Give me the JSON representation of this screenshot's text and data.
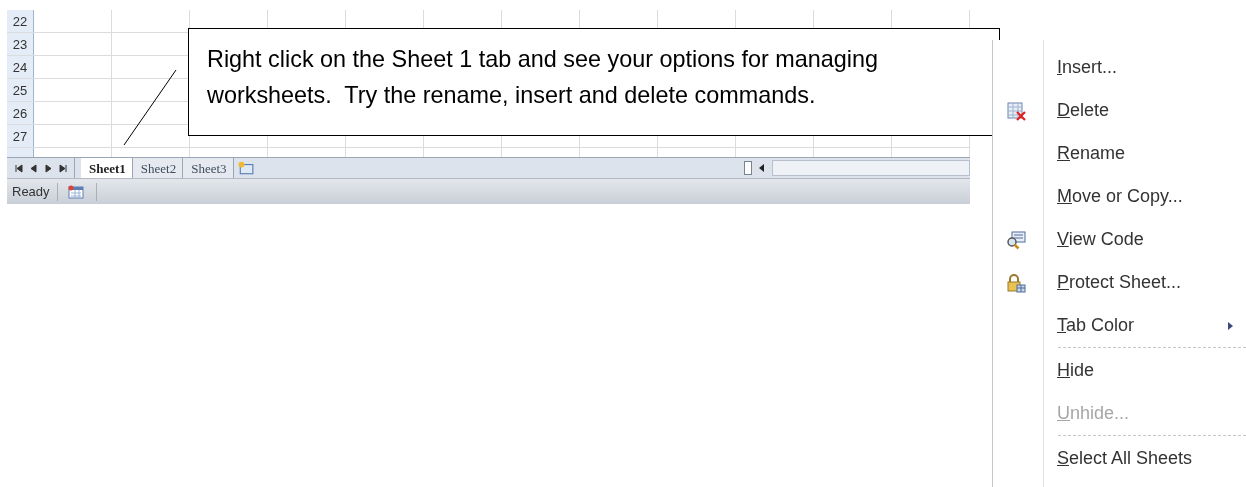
{
  "grid": {
    "row_labels": [
      "22",
      "23",
      "24",
      "25",
      "26",
      "27"
    ]
  },
  "sheet_tabs": [
    {
      "label": "Sheet1",
      "selected": true
    },
    {
      "label": "Sheet2",
      "selected": false
    },
    {
      "label": "Sheet3",
      "selected": false
    }
  ],
  "status_bar": {
    "text": "Ready"
  },
  "callout": {
    "text": "Right click on the Sheet 1 tab and see your options for managing worksheets.  Try the rename, insert and delete commands."
  },
  "context_menu": {
    "items": [
      {
        "kind": "item",
        "label": "Insert...",
        "disabled": false,
        "submenu": false
      },
      {
        "kind": "delete",
        "label": "Delete",
        "disabled": false,
        "submenu": false
      },
      {
        "kind": "item",
        "label": "Rename",
        "disabled": false,
        "submenu": false
      },
      {
        "kind": "item",
        "label": "Move or Copy...",
        "disabled": false,
        "submenu": false
      },
      {
        "kind": "code",
        "label": "View Code",
        "disabled": false,
        "submenu": false
      },
      {
        "kind": "lock",
        "label": "Protect Sheet...",
        "disabled": false,
        "submenu": false
      },
      {
        "kind": "item",
        "label": "Tab Color",
        "disabled": false,
        "submenu": true
      },
      {
        "kind": "separator"
      },
      {
        "kind": "item",
        "label": "Hide",
        "disabled": false,
        "submenu": false
      },
      {
        "kind": "item",
        "label": "Unhide...",
        "disabled": true,
        "submenu": false
      },
      {
        "kind": "separator"
      },
      {
        "kind": "item",
        "label": "Select All Sheets",
        "disabled": false,
        "submenu": false
      }
    ]
  }
}
